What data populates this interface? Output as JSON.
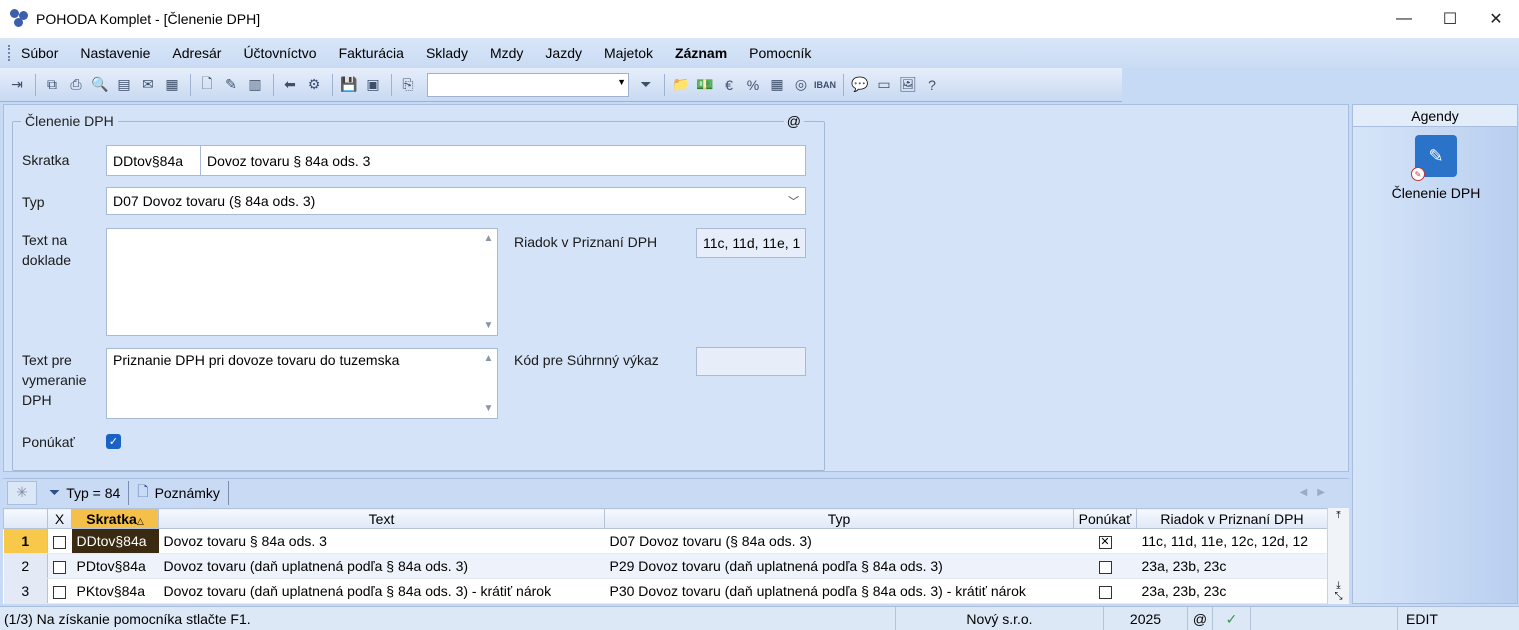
{
  "window": {
    "title": "POHODA Komplet - [Členenie DPH]",
    "minimize": "—",
    "maximize": "☐",
    "close": "✕"
  },
  "menu": [
    "Súbor",
    "Nastavenie",
    "Adresár",
    "Účtovníctvo",
    "Fakturácia",
    "Sklady",
    "Mzdy",
    "Jazdy",
    "Majetok",
    "Záznam",
    "Pomocník"
  ],
  "toolbar": {
    "combo_value": "",
    "iban_label": "IBAN"
  },
  "form": {
    "group_title": "Členenie DPH",
    "at_symbol": "@",
    "skratka_label": "Skratka",
    "skratka_code": "DDtov§84a",
    "skratka_text": "Dovoz tovaru § 84a ods. 3",
    "typ_label": "Typ",
    "typ_value": "D07 Dovoz tovaru (§ 84a ods. 3)",
    "text_na_doklade_label1": "Text na",
    "text_na_doklade_label2": "doklade",
    "text_na_doklade_value": "",
    "riadok_label": "Riadok v Priznaní DPH",
    "riadok_value": "11c, 11d, 11e, 1",
    "text_pre_label1": "Text pre",
    "text_pre_label2": "vymeranie",
    "text_pre_label3": "DPH",
    "text_pre_value": "Priznanie DPH pri dovoze tovaru do tuzemska",
    "kod_label": "Kód pre Súhrnný výkaz",
    "kod_value": "",
    "ponukat_label": "Ponúkať",
    "ponukat_checked": true
  },
  "agendy": {
    "header": "Agendy",
    "tile_label": "Členenie DPH"
  },
  "tabs": {
    "star": "✳",
    "filter_label": "Typ = 84",
    "notes_label": "Poznámky"
  },
  "grid": {
    "columns": [
      "X",
      "Skratka",
      "Text",
      "Typ",
      "Ponúkať",
      "Riadok v Priznaní DPH"
    ],
    "rows": [
      {
        "n": "1",
        "skratka": "DDtov§84a",
        "text": "Dovoz tovaru § 84a ods. 3",
        "typ": "D07 Dovoz tovaru (§ 84a ods. 3)",
        "ponukat": true,
        "riadok": "11c, 11d, 11e, 12c, 12d, 12"
      },
      {
        "n": "2",
        "skratka": "PDtov§84a",
        "text": "Dovoz tovaru (daň uplatnená podľa § 84a ods. 3)",
        "typ": "P29 Dovoz tovaru (daň uplatnená podľa § 84a ods. 3)",
        "ponukat": false,
        "riadok": "23a, 23b, 23c"
      },
      {
        "n": "3",
        "skratka": "PKtov§84a",
        "text": "Dovoz tovaru (daň uplatnená podľa § 84a ods. 3) - krátiť nárok",
        "typ": "P30 Dovoz tovaru (daň uplatnená podľa § 84a ods. 3) - krátiť nárok",
        "ponukat": false,
        "riadok": "23a, 23b, 23c"
      }
    ]
  },
  "status": {
    "hint": "(1/3) Na získanie pomocníka stlačte F1.",
    "company": "Nový s.r.o.",
    "year": "2025",
    "at": "@",
    "check": "✓",
    "mode": "EDIT"
  }
}
